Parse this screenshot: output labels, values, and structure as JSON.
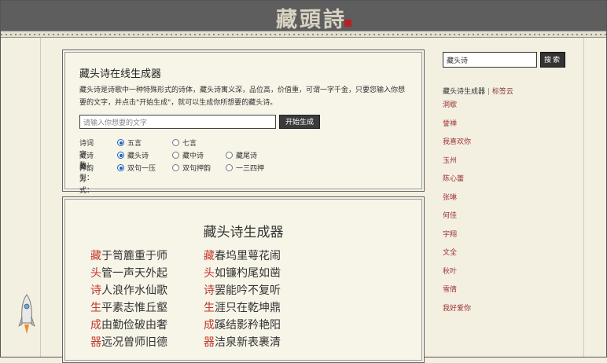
{
  "header": {
    "logo_text": "藏頭詩"
  },
  "generator": {
    "title": "藏头诗在线生成器",
    "description": "藏头诗是诗歌中一种特殊形式的诗体，藏头诗寓义深，品位高，价值重，可谓一字千金，只要您输入你想要的文字，并点击\"开始生成\"，就可以生成你所想要的藏头诗。",
    "input_placeholder": "请输入你想要的文字",
    "generate_label": "开始生成",
    "options": [
      {
        "label": "诗词字数：",
        "choices": [
          {
            "text": "五言",
            "selected": true
          },
          {
            "text": "七言",
            "selected": false
          }
        ]
      },
      {
        "label": "藏诗类型：",
        "choices": [
          {
            "text": "藏头诗",
            "selected": true
          },
          {
            "text": "藏中诗",
            "selected": false
          },
          {
            "text": "藏尾诗",
            "selected": false
          }
        ]
      },
      {
        "label": "押韵方式：",
        "choices": [
          {
            "text": "双句一压",
            "selected": true
          },
          {
            "text": "双句押韵",
            "selected": false
          },
          {
            "text": "一三四押",
            "selected": false
          }
        ]
      }
    ]
  },
  "result": {
    "title": "藏头诗生成器",
    "poem_left": [
      {
        "head": "藏",
        "rest": "于笥簏重于师"
      },
      {
        "head": "头",
        "rest": "管一声天外起"
      },
      {
        "head": "诗",
        "rest": "人浪作水仙歌"
      },
      {
        "head": "生",
        "rest": "平素志惟丘壑"
      },
      {
        "head": "成",
        "rest": "由勤俭破由奢"
      },
      {
        "head": "器",
        "rest": "远况曾师旧德"
      }
    ],
    "poem_right": [
      {
        "head": "藏",
        "rest": "春坞里萼花闹"
      },
      {
        "head": "头",
        "rest": "如镰杓尾如凿"
      },
      {
        "head": "诗",
        "rest": "罢能吟不复听"
      },
      {
        "head": "生",
        "rest": "涯只在乾坤鼎"
      },
      {
        "head": "成",
        "rest": "蹊结影矜艳阳"
      },
      {
        "head": "器",
        "rest": "洁泉新表裹清"
      }
    ]
  },
  "sidebar": {
    "search_value": "藏头诗",
    "search_label": "搜索",
    "tag_head": {
      "current": "藏头诗生成器",
      "separator": "|",
      "link": "标签云"
    },
    "tags": [
      "洞歇",
      "誉禅",
      "我喜欢你",
      "玉州",
      "陈心蕾",
      "张琳",
      "何佳",
      "宇翔",
      "文全",
      "秋叶",
      "雪倩",
      "我好爱你"
    ]
  }
}
